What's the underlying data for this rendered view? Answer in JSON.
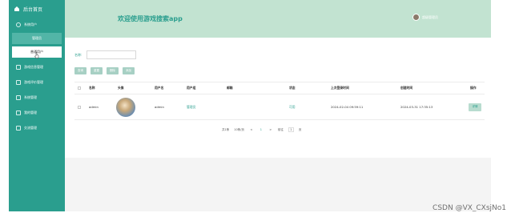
{
  "sidebar": {
    "title": "后台首页",
    "items": [
      {
        "label": "系统用户"
      },
      {
        "label": "游戏信息管理"
      },
      {
        "label": "游戏评价管理"
      },
      {
        "label": "系统管理"
      },
      {
        "label": "我的管理"
      },
      {
        "label": "交流管理"
      }
    ],
    "subs": [
      {
        "label": "管理员"
      },
      {
        "label": "普通用户"
      }
    ]
  },
  "header": {
    "title": "欢迎使用游戏搜索app",
    "user": "超级管理员"
  },
  "search": {
    "label": "名称:",
    "placeholder": ""
  },
  "toolbar": {
    "query": "查询",
    "reset": "重置",
    "delete": "删除",
    "add": "添加"
  },
  "table": {
    "headers": [
      "名称",
      "头像",
      "用户名",
      "用户组",
      "邮箱",
      "状态",
      "上次登录时间",
      "创建时间",
      "操作"
    ],
    "rows": [
      {
        "name": "admin",
        "username": "admin",
        "group": "管理员",
        "email": "",
        "status": "可用",
        "last_login": "2024-02-04 09:59:11",
        "created": "2024-03-31 17:35:13",
        "action": "详情"
      }
    ]
  },
  "pager": {
    "total": "共1条",
    "per_page": "10条/页",
    "prev": "<",
    "page": "1",
    "next": ">",
    "goto": "前往",
    "goto_page": "1",
    "page_unit": "页"
  },
  "watermark": "CSDN @VX_CXsjNo1",
  "colors": {
    "brand": "#2a9e8e",
    "header_bg": "#c2e3d1",
    "button_bg": "#a7d0c4"
  }
}
